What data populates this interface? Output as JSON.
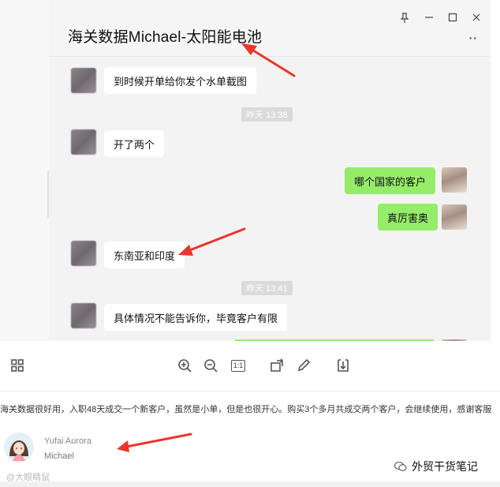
{
  "window": {
    "title": "海关数据Michael-太阳能电池",
    "controls": {
      "pin": "⊥",
      "minimize": "—",
      "maximize": "☐",
      "close": "✕"
    },
    "more": "··"
  },
  "messages": [
    {
      "side": "in",
      "text": "到时候开单给你发个水单截图"
    },
    {
      "type": "time",
      "text": "昨天 13:38"
    },
    {
      "side": "in",
      "text": "开了两个"
    },
    {
      "side": "out",
      "text": "哪个国家的客户"
    },
    {
      "side": "out",
      "text": "真厉害奥"
    },
    {
      "side": "in",
      "text": "东南亚和印度"
    },
    {
      "type": "time",
      "text": "昨天 13:41"
    },
    {
      "side": "in",
      "text": "具体情况不能告诉你，毕竟客户有限"
    }
  ],
  "toolbar": {
    "ratio_label": "1:1",
    "icons": [
      "grid-icon",
      "zoom-in-icon",
      "zoom-out-icon",
      "actual-size-icon",
      "rotate-icon",
      "edit-icon",
      "download-icon"
    ]
  },
  "review": {
    "text": "海关数据很好用，入职48天成交一个新客户，虽然是小单，但是也很开心。购买3个多月共成交两个客户，会继续使用，感谢客服",
    "reviewer_name": "Yufai Aurora",
    "reviewer_sub": "Michael"
  },
  "watermarks": {
    "left": "@大眼睛鼠",
    "right": "外贸干货笔记"
  },
  "colors": {
    "outgoing_bubble": "#95ec69",
    "incoming_bubble": "#ffffff",
    "chat_bg": "#f3f3f3",
    "arrow": "#e8362c"
  }
}
